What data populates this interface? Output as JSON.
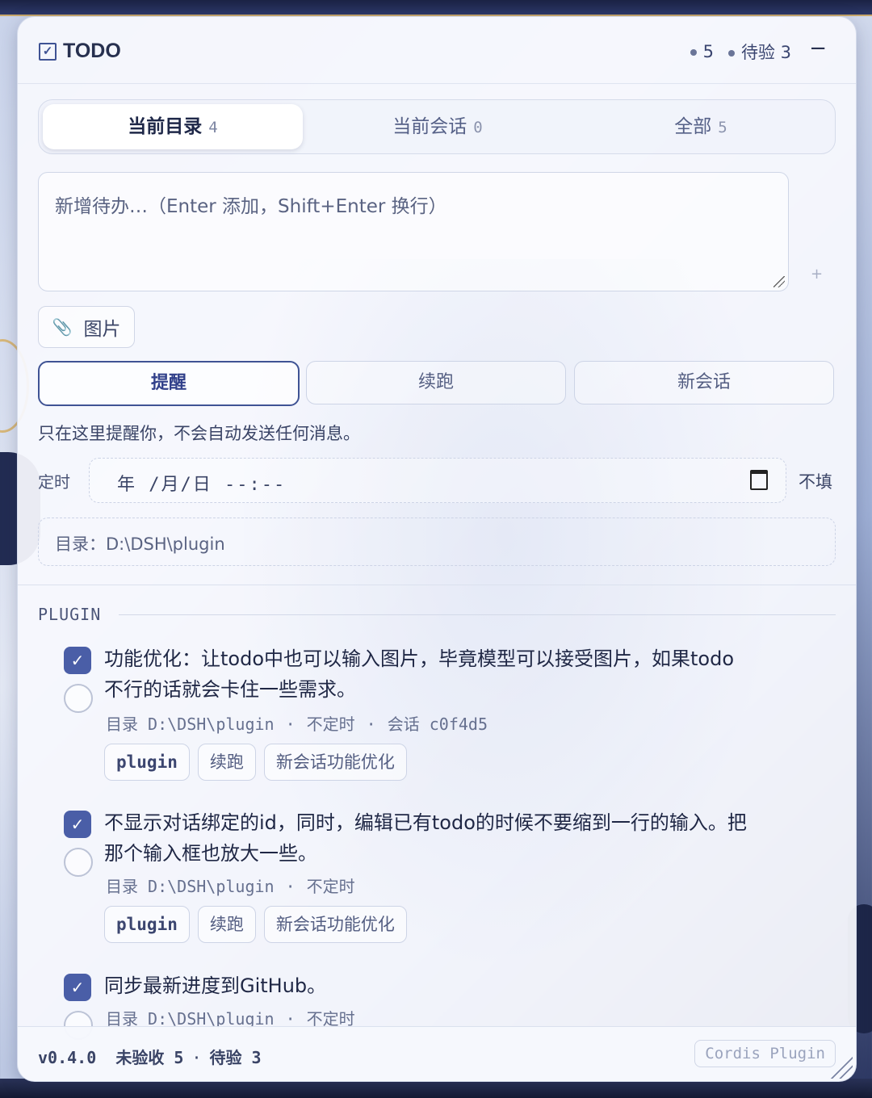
{
  "header": {
    "title": "TODO",
    "stat_total": "5",
    "stat_pending_label": "待验",
    "stat_pending_count": "3",
    "minimize": "−"
  },
  "tabs": [
    {
      "label": "当前目录",
      "count": "4"
    },
    {
      "label": "当前会话",
      "count": "0"
    },
    {
      "label": "全部",
      "count": "5"
    }
  ],
  "composer": {
    "placeholder": "新增待办…（Enter 添加，Shift+Enter 换行）",
    "image_button": "图片",
    "add_hint": "+"
  },
  "modes": [
    "提醒",
    "续跑",
    "新会话"
  ],
  "mode_hint": "只在这里提醒你，不会自动发送任何消息。",
  "schedule": {
    "label": "定时",
    "value": "年 /月/日 --:--",
    "nofill": "不填"
  },
  "directory_label": "目录：D:\\DSH\\plugin",
  "section_title": "PLUGIN",
  "todos": [
    {
      "text": "功能优化：让todo中也可以输入图片，毕竟模型可以接受图片，如果todo不行的话就会卡住一些需求。",
      "dir_label": "目录",
      "dir": "D:\\DSH\\plugin",
      "schedule": "不定时",
      "session_label": "会话",
      "session": "c0f4d5",
      "tags": [
        "plugin",
        "续跑",
        "新会话功能优化"
      ]
    },
    {
      "text": "不显示对话绑定的id，同时，编辑已有todo的时候不要缩到一行的输入。把那个输入框也放大一些。",
      "dir_label": "目录",
      "dir": "D:\\DSH\\plugin",
      "schedule": "不定时",
      "tags": [
        "plugin",
        "续跑",
        "新会话功能优化"
      ]
    },
    {
      "text": "同步最新进度到GitHub。",
      "dir_label": "目录",
      "dir": "D:\\DSH\\plugin",
      "schedule": "不定时"
    }
  ],
  "footer": {
    "version": "v0.4.0",
    "unaccepted": "未验收 5",
    "pending": "待验 3",
    "brand": "Cordis Plugin"
  },
  "colors": {
    "accent": "#4a5ea7",
    "text": "#1f2745",
    "muted": "#66708f"
  }
}
